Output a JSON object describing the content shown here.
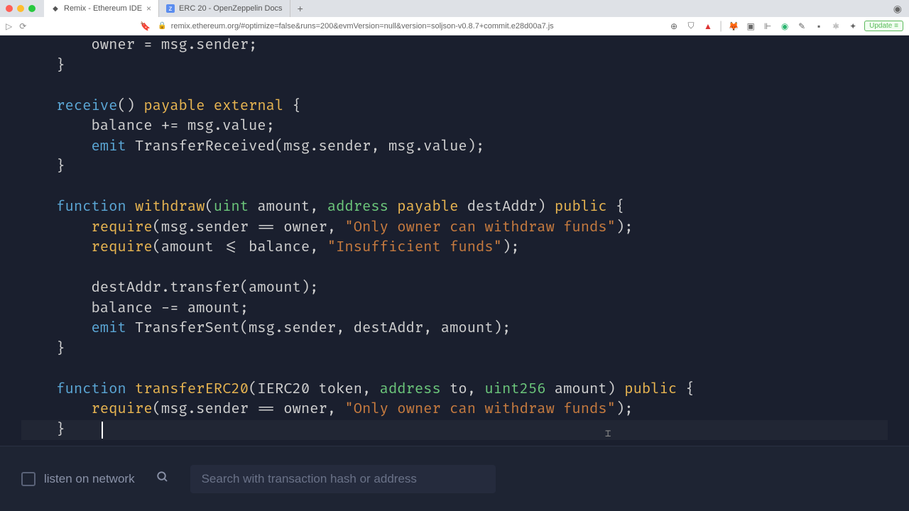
{
  "browser": {
    "tabs": [
      {
        "title": "Remix - Ethereum IDE",
        "favicon": "◆",
        "active": true
      },
      {
        "title": "ERC 20 - OpenZeppelin Docs",
        "favicon": "z",
        "active": false
      }
    ],
    "url": "remix.ethereum.org/#optimize=false&runs=200&evmVersion=null&version=soljson-v0.8.7+commit.e28d00a7.js",
    "update_label": "Update"
  },
  "extensions": [
    {
      "name": "metamask",
      "glyph": "🦊"
    },
    {
      "name": "docs",
      "glyph": "▣"
    },
    {
      "name": "monitor",
      "glyph": "⊩"
    },
    {
      "name": "grammarly",
      "glyph": "◉"
    },
    {
      "name": "eyedropper",
      "glyph": "✎"
    },
    {
      "name": "dark",
      "glyph": "▪"
    },
    {
      "name": "react",
      "glyph": "⚛"
    },
    {
      "name": "puzzle",
      "glyph": "✦"
    }
  ],
  "code": {
    "l1": "        owner = msg.sender;",
    "l2": "    }",
    "l4_receive": "receive",
    "l4_paren": "()",
    "l4_payable": "payable",
    "l4_external": "external",
    "l4_brace": " {",
    "l5": "        balance += msg.value;",
    "l6_emit": "emit",
    "l6_body": " TransferReceived(msg.sender, msg.value);",
    "l7": "    }",
    "l9_function": "function",
    "l9_name": " withdraw",
    "l9_open": "(",
    "l9_uint": "uint",
    "l9_amount": " amount, ",
    "l9_address": "address",
    "l9_payable": "payable",
    "l9_dest": " destAddr) ",
    "l9_public": "public",
    "l9_brace": " {",
    "l10_require": "require",
    "l10_cond": "(msg.sender == owner, ",
    "l10_str": "\"Only owner can withdraw funds\"",
    "l10_end": ");",
    "l11_require": "require",
    "l11_cond": "(amount <= balance, ",
    "l11_str": "\"Insufficient funds\"",
    "l11_end": ");",
    "l13": "        destAddr.transfer(amount);",
    "l14": "        balance -= amount;",
    "l15_emit": "emit",
    "l15_body": " TransferSent(msg.sender, destAddr, amount);",
    "l16": "    }",
    "l18_function": "function",
    "l18_name": " transferERC20",
    "l18_open": "(IERC20 token, ",
    "l18_address": "address",
    "l18_to": " to, ",
    "l18_uint256": "uint256",
    "l18_amount": " amount) ",
    "l18_public": "public",
    "l18_brace": " {",
    "l19_require": "require",
    "l19_cond": "(msg.sender == owner, ",
    "l19_str": "\"Only owner can withdraw funds\"",
    "l19_end": ");",
    "l20": "    }    "
  },
  "console": {
    "listen_label": "listen on network",
    "search_placeholder": "Search with transaction hash or address"
  }
}
